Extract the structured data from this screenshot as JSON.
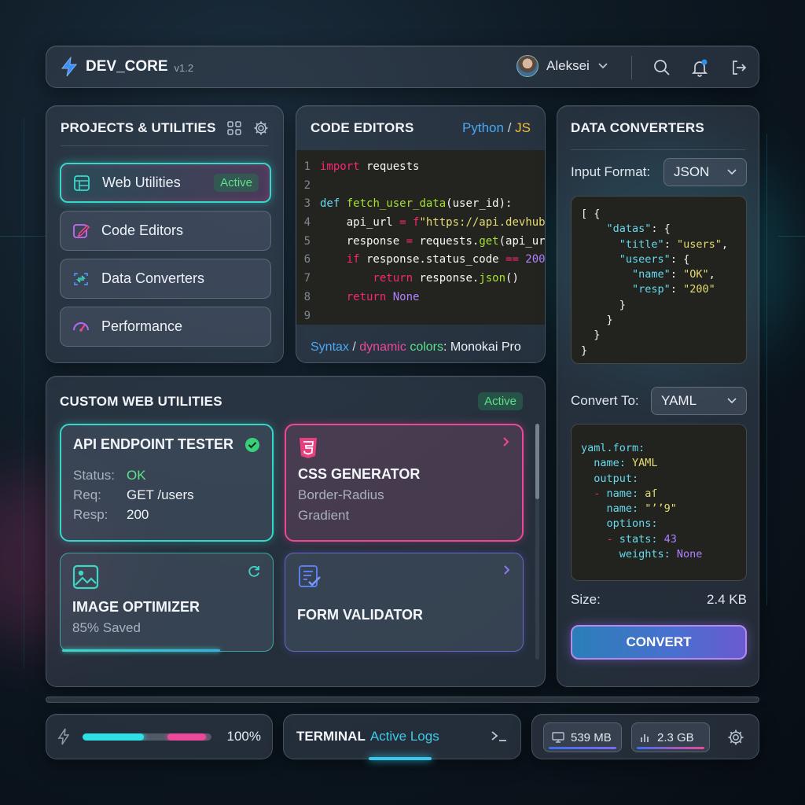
{
  "topbar": {
    "app_name": "DEV_CORE",
    "version": "v1.2",
    "user_name": "Aleksei"
  },
  "projects": {
    "title": "PROJECTS & UTILITIES",
    "items": [
      {
        "label": "Web Utilities",
        "icon": "web-grid-icon",
        "badge": "Active"
      },
      {
        "label": "Code Editors",
        "icon": "edit-icon"
      },
      {
        "label": "Data Converters",
        "icon": "convert-icon"
      },
      {
        "label": "Performance",
        "icon": "gauge-icon"
      }
    ]
  },
  "code_editor": {
    "title": "CODE EDITORS",
    "lang_primary": "Python",
    "lang_sep": "/",
    "lang_secondary": "JS",
    "footer_syntax": "Syntax",
    "footer_sep": "/",
    "footer_dynamic": "dynamic",
    "footer_colors": "colors",
    "footer_theme": ": Monokai Pro",
    "line_numbers": [
      "1",
      "2",
      "3",
      "4",
      "5",
      "6",
      "7",
      "8",
      "9"
    ],
    "code": {
      "l1_import": "import",
      "l1_rest": " requests",
      "l3_def": "def",
      "l3_fn": "fetch_user_data",
      "l3_rest": "(user_id):",
      "l4_pre": "    api_url ",
      "l4_eq": "=",
      "l4_f": " f",
      "l4_str": "\"https://api.devhub",
      "l5_pre": "    response ",
      "l5_eq": "=",
      "l5_mid": " requests.",
      "l5_fn": "get",
      "l5_rest": "(api_ur",
      "l6_if": "    if",
      "l6_mid": " response.status_code ",
      "l6_eq": "==",
      "l6_num": " 200",
      "l7_ret": "        return",
      "l7_mid": " response.",
      "l7_fn": "json",
      "l7_rest": "()",
      "l8_ret": "    return",
      "l8_none": " None"
    },
    "colors": {
      "keyword": "#f92672",
      "function": "#a6e22e",
      "string": "#e6db74",
      "number": "#ae81ff",
      "background": "#23241f"
    }
  },
  "converters": {
    "title": "DATA CONVERTERS",
    "input_label": "Input Format:",
    "input_value": "JSON",
    "json_lines": [
      {
        "p": "[ {",
        "k": "",
        "s": "",
        "q": ""
      },
      {
        "p": "    ",
        "k": "\"datas\"",
        "s": "",
        "q": ": {"
      },
      {
        "p": "      ",
        "k": "\"title\"",
        "s": "\"users\"",
        "q": ","
      },
      {
        "p": "      ",
        "k": "\"useers\"",
        "s": "",
        "q": ": {"
      },
      {
        "p": "        ",
        "k": "\"name\"",
        "s": "\"OK\"",
        "q": ","
      },
      {
        "p": "        ",
        "k": "\"resp\"",
        "s": "\"200\"",
        "q": ""
      },
      {
        "p": "      }",
        "k": "",
        "s": "",
        "q": ""
      },
      {
        "p": "    }",
        "k": "",
        "s": "",
        "q": ""
      },
      {
        "p": "  }",
        "k": "",
        "s": "",
        "q": ""
      },
      {
        "p": "}",
        "k": "",
        "s": "",
        "q": ""
      }
    ],
    "output_label": "Convert To:",
    "output_value": "YAML",
    "yaml": {
      "l1": "yaml.form:",
      "l2k": "  name:",
      "l2v": " YAML",
      "l3": "  output:",
      "l4d": "  -",
      "l4k": " name:",
      "l4v": " aſ",
      "l5k": "    name:",
      "l5v": " \"ʼʼ9\"",
      "l6": "    options:",
      "l7d": "    -",
      "l7k": " stats:",
      "l7v": " 43",
      "l8k": "      weights:",
      "l8v": " None"
    },
    "size_label": "Size:",
    "size_value": "2.4 KB",
    "button": "CONVERT"
  },
  "utilities": {
    "title": "CUSTOM WEB UTILITIES",
    "badge": "Active",
    "cards": {
      "api": {
        "title": "API ENDPOINT TESTER",
        "status_k": "Status:",
        "status_v": "OK",
        "req_k": "Req:",
        "req_v": "GET /users",
        "resp_k": "Resp:",
        "resp_v": "200"
      },
      "css": {
        "title": "CSS GENERATOR",
        "line1": "Border-Radius",
        "line2": "Gradient"
      },
      "image": {
        "title": "IMAGE OPTIMIZER",
        "line1": "85% Saved",
        "progress": 0.75
      },
      "form": {
        "title": "FORM VALIDATOR"
      }
    }
  },
  "statusbar": {
    "power_pct": "100%",
    "power_level": 1.0,
    "terminal_title": "TERMINAL",
    "terminal_sub": "Active Logs",
    "memory": "539 MB",
    "storage": "2.3 GB"
  },
  "theme": {
    "accent_cyan": "#36d6c8",
    "accent_pink": "#ec4899",
    "accent_green": "#5ee08a",
    "accent_purple": "#8b7cf0"
  }
}
